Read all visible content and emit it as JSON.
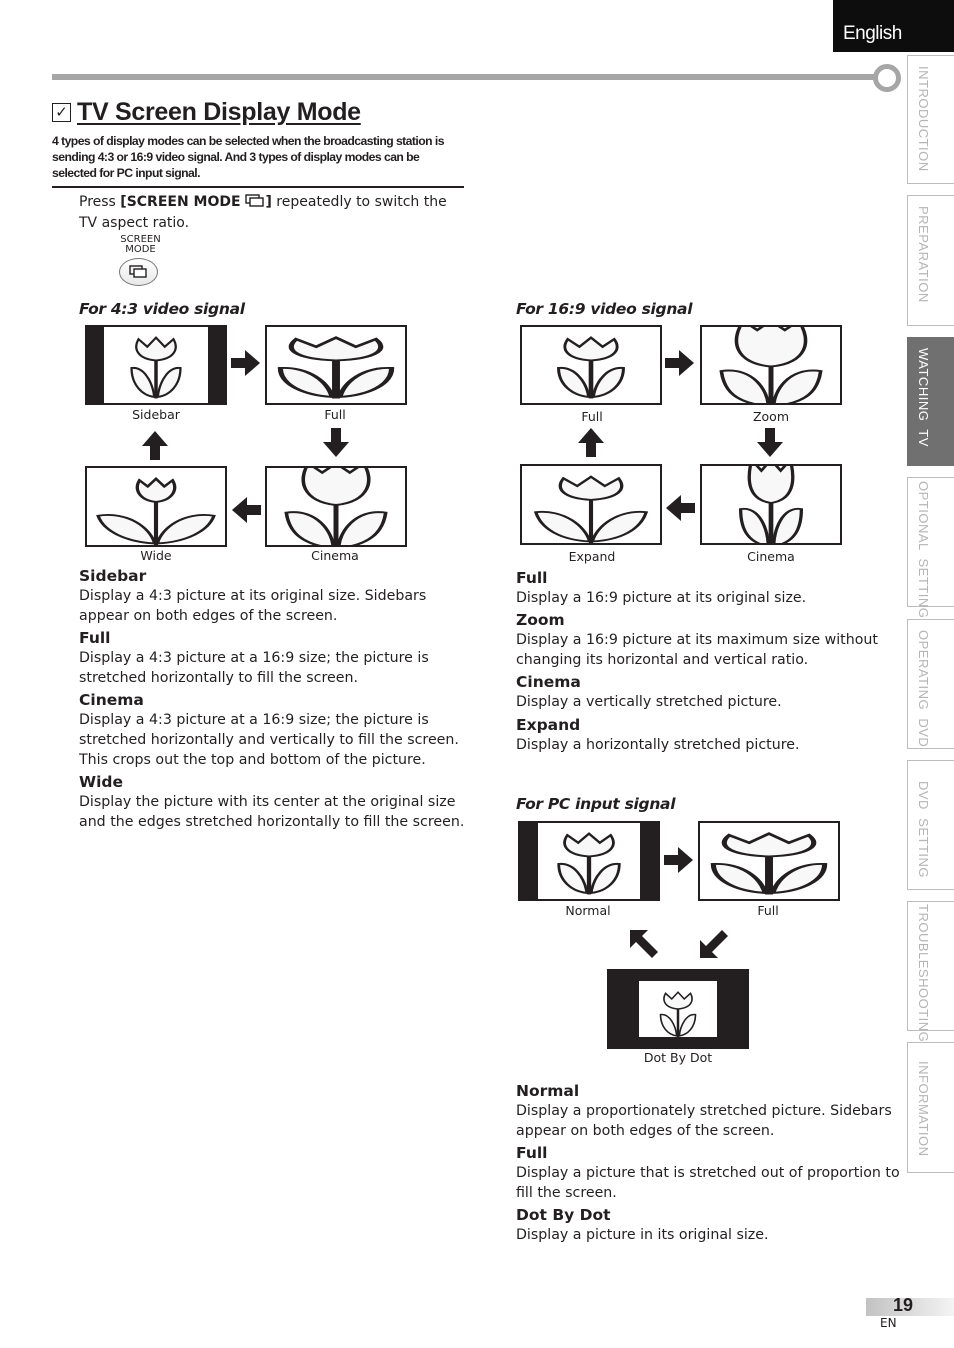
{
  "header": {
    "language_tab": "English"
  },
  "side_tabs": [
    {
      "label": "INTRODUCTION",
      "active": false
    },
    {
      "label": "PREPARATION",
      "active": false
    },
    {
      "label": "WATCHING  TV",
      "active": true
    },
    {
      "label": "OPTIONAL  SETTING",
      "active": false
    },
    {
      "label": "OPERATING  DVD",
      "active": false
    },
    {
      "label": "DVD  SETTING",
      "active": false
    },
    {
      "label": "TROUBLESHOOTING",
      "active": false
    },
    {
      "label": "INFORMATION",
      "active": false
    }
  ],
  "title": {
    "checkbox_glyph": "✓",
    "text": "TV Screen Display Mode"
  },
  "intro": "4 types of display modes can be selected when the broadcasting station is sending 4:3 or 16:9 video signal. And 3 types of display modes can be selected for PC input signal.",
  "instruction": {
    "prefix": "Press ",
    "button_name": "[SCREEN MODE ",
    "button_close": "]",
    "suffix": " repeatedly to switch the TV aspect ratio.",
    "button_label_line1": "SCREEN",
    "button_label_line2": "MODE"
  },
  "signal_43": {
    "heading": "For 4:3 video signal",
    "captions": {
      "sidebar": "Sidebar",
      "full": "Full",
      "wide": "Wide",
      "cinema": "Cinema"
    },
    "modes": [
      {
        "name": "Sidebar",
        "desc": "Display a 4:3 picture at its original size. Sidebars appear on both edges of the screen."
      },
      {
        "name": "Full",
        "desc": "Display a 4:3 picture at a 16:9 size; the picture is stretched horizontally to fill the screen."
      },
      {
        "name": "Cinema",
        "desc": "Display a 4:3 picture at a 16:9 size; the picture is stretched horizontally and vertically to fill the screen. This crops out the top and bottom of the picture."
      },
      {
        "name": "Wide",
        "desc": "Display the picture with its center at the original size and the edges stretched horizontally to fill the screen."
      }
    ]
  },
  "signal_169": {
    "heading": "For 16:9 video signal",
    "captions": {
      "full": "Full",
      "zoom": "Zoom",
      "expand": "Expand",
      "cinema": "Cinema"
    },
    "modes": [
      {
        "name": "Full",
        "desc": "Display a 16:9 picture at its original size."
      },
      {
        "name": "Zoom",
        "desc": "Display a 16:9 picture at its maximum size without changing its horizontal and vertical ratio."
      },
      {
        "name": "Cinema",
        "desc": "Display a vertically stretched picture."
      },
      {
        "name": "Expand",
        "desc": "Display a horizontally stretched picture."
      }
    ]
  },
  "signal_pc": {
    "heading": "For PC input signal",
    "captions": {
      "normal": "Normal",
      "full": "Full",
      "dotbydot": "Dot By Dot"
    },
    "modes": [
      {
        "name": "Normal",
        "desc": "Display a proportionately stretched picture. Sidebars appear on both edges of the screen."
      },
      {
        "name": "Full",
        "desc": "Display a picture that is stretched out of proportion to fill the screen."
      },
      {
        "name": "Dot By Dot",
        "desc": "Display a picture in its original size."
      }
    ]
  },
  "footer": {
    "page_number": "19",
    "locale": "EN"
  }
}
